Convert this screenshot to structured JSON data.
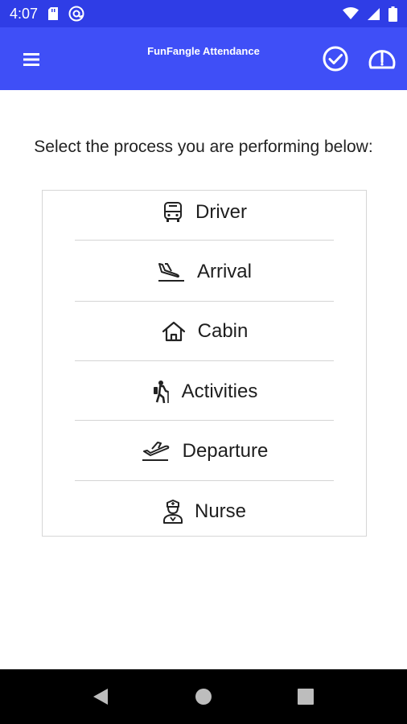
{
  "status_bar": {
    "time": "4:07",
    "icons": [
      "sd-card-icon",
      "at-sign-icon",
      "wifi-icon",
      "signal-icon",
      "battery-icon"
    ]
  },
  "app_bar": {
    "title": "FunFangle Attendance",
    "icons": [
      "menu-icon",
      "check-circle-icon",
      "gauge-icon"
    ],
    "color": "#3f4ff7",
    "status_color": "#2f3de6"
  },
  "main": {
    "prompt": "Select the process you are performing below:",
    "options": [
      {
        "label": "Driver",
        "icon": "bus-icon"
      },
      {
        "label": "Arrival",
        "icon": "plane-landing-icon"
      },
      {
        "label": "Cabin",
        "icon": "house-icon"
      },
      {
        "label": "Activities",
        "icon": "hiker-icon"
      },
      {
        "label": "Departure",
        "icon": "plane-departure-icon"
      },
      {
        "label": "Nurse",
        "icon": "nurse-icon"
      }
    ]
  },
  "nav_bar": {
    "icons": [
      "back-triangle-icon",
      "home-circle-icon",
      "recents-square-icon"
    ]
  }
}
